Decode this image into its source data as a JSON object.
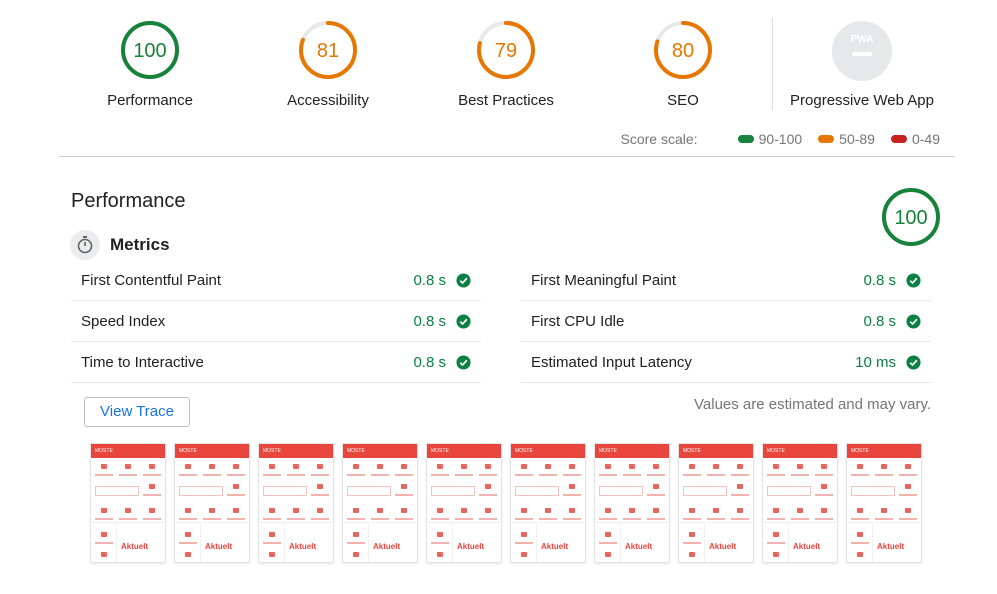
{
  "categories": [
    {
      "label": "Performance",
      "score": 100,
      "color": "#178239"
    },
    {
      "label": "Accessibility",
      "score": 81,
      "color": "#e67700"
    },
    {
      "label": "Best Practices",
      "score": 79,
      "color": "#e67700"
    },
    {
      "label": "SEO",
      "score": 80,
      "color": "#e67700"
    }
  ],
  "pwa": {
    "label": "Progressive Web App",
    "badge": "PWA"
  },
  "score_scale": {
    "title": "Score scale:",
    "ranges": [
      {
        "label": "90-100",
        "color": "#178239"
      },
      {
        "label": "50-89",
        "color": "#e67700"
      },
      {
        "label": "0-49",
        "color": "#c7221f"
      }
    ]
  },
  "performance_section": {
    "title": "Performance",
    "score": 100,
    "color": "#178239"
  },
  "metrics": {
    "title": "Metrics",
    "left": [
      {
        "label": "First Contentful Paint",
        "value": "0.8 s"
      },
      {
        "label": "Speed Index",
        "value": "0.8 s"
      },
      {
        "label": "Time to Interactive",
        "value": "0.8 s"
      }
    ],
    "right": [
      {
        "label": "First Meaningful Paint",
        "value": "0.8 s"
      },
      {
        "label": "First CPU Idle",
        "value": "0.8 s"
      },
      {
        "label": "Estimated Input Latency",
        "value": "10 ms"
      }
    ],
    "pass_color": "#0b8043"
  },
  "view_trace_label": "View Trace",
  "estimate_note": "Values are estimated and may vary.",
  "filmstrip": {
    "frame_count": 10,
    "frame_header": "MOSTE",
    "frame_main_label": "Aktuelt"
  }
}
